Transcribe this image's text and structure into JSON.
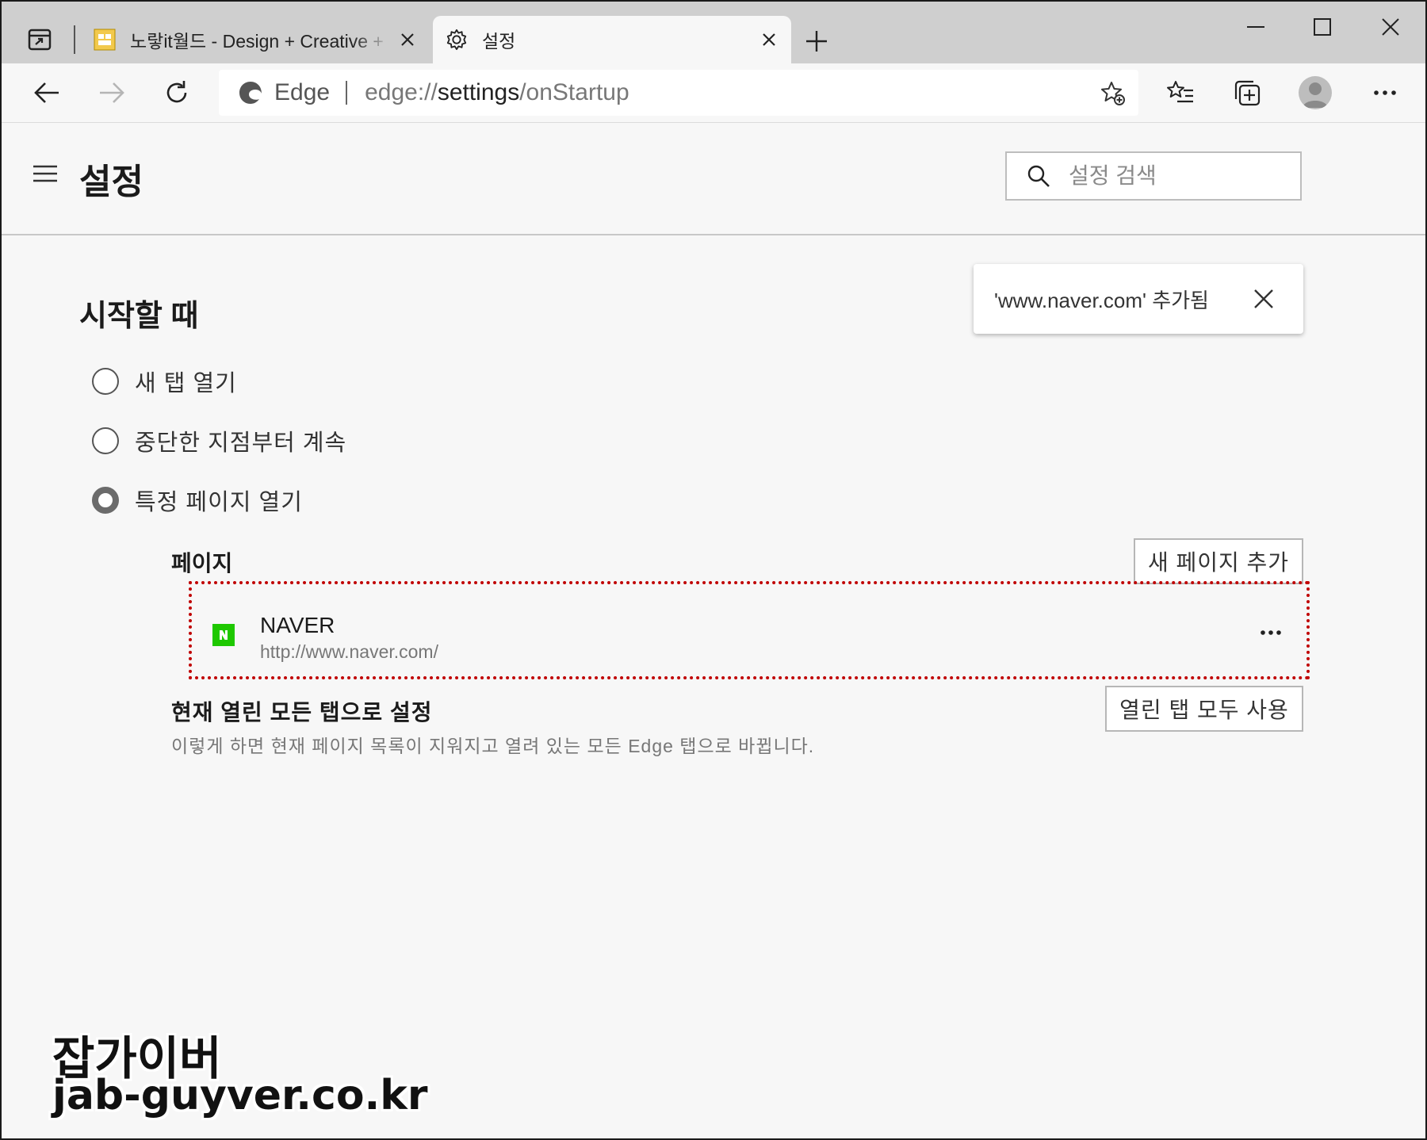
{
  "browser": {
    "tabs": [
      {
        "title": "노랗it월드 - Design + Creative + ",
        "active": false,
        "favicon": "site-favicon"
      },
      {
        "title": "설정",
        "active": true,
        "favicon": "gear-icon"
      }
    ],
    "address": {
      "site_label": "Edge",
      "url_prefix": "edge://",
      "url_main": "settings",
      "url_suffix": "/onStartup"
    }
  },
  "settings": {
    "title": "설정",
    "search_placeholder": "설정 검색"
  },
  "toast": {
    "message": "'www.naver.com' 추가됨"
  },
  "startup": {
    "section_title": "시작할 때",
    "options": [
      {
        "label": "새 탭 열기",
        "checked": false
      },
      {
        "label": "중단한 지점부터 계속",
        "checked": false
      },
      {
        "label": "특정 페이지 열기",
        "checked": true
      }
    ],
    "pages_label": "페이지",
    "add_page_button": "새 페이지 추가",
    "pages": [
      {
        "name": "NAVER",
        "url": "http://www.naver.com/"
      }
    ],
    "use_open_tabs_title": "현재 열린 모든 탭으로 설정",
    "use_open_tabs_desc": "이렇게 하면 현재 페이지 목록이 지워지고 열려 있는 모든 Edge 탭으로 바뀝니다.",
    "use_open_tabs_button": "열린 탭 모두 사용"
  },
  "watermark": {
    "line1": "잡가이버",
    "line2": "jab-guyver.co.kr"
  },
  "colors": {
    "highlight_border": "#c00000",
    "naver_green": "#1ec800",
    "tabstrip_bg": "#cfcfcf",
    "page_bg": "#f7f7f7"
  }
}
